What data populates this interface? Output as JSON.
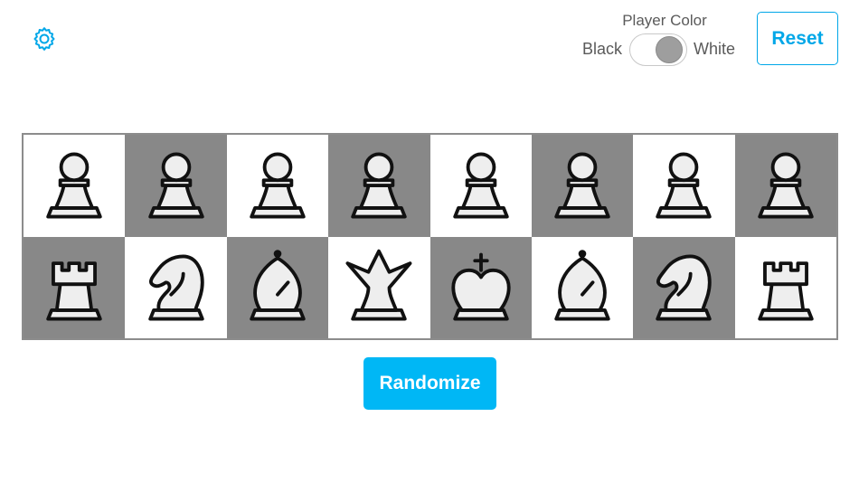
{
  "toolbar": {
    "settings_icon": "gear-icon",
    "player_color": {
      "label": "Player Color",
      "left_option": "Black",
      "right_option": "White",
      "selected": "White"
    },
    "reset_label": "Reset"
  },
  "board": {
    "piece_color": "white",
    "rows": [
      [
        "pawn",
        "pawn",
        "pawn",
        "pawn",
        "pawn",
        "pawn",
        "pawn",
        "pawn"
      ],
      [
        "rook",
        "knight",
        "bishop",
        "queen",
        "king",
        "bishop",
        "knight",
        "rook"
      ]
    ],
    "light_square_color": "#ffffff",
    "dark_square_color": "#888888"
  },
  "randomize_label": "Randomize",
  "colors": {
    "accent": "#00a7e8",
    "button_fill": "#00b7f5"
  }
}
